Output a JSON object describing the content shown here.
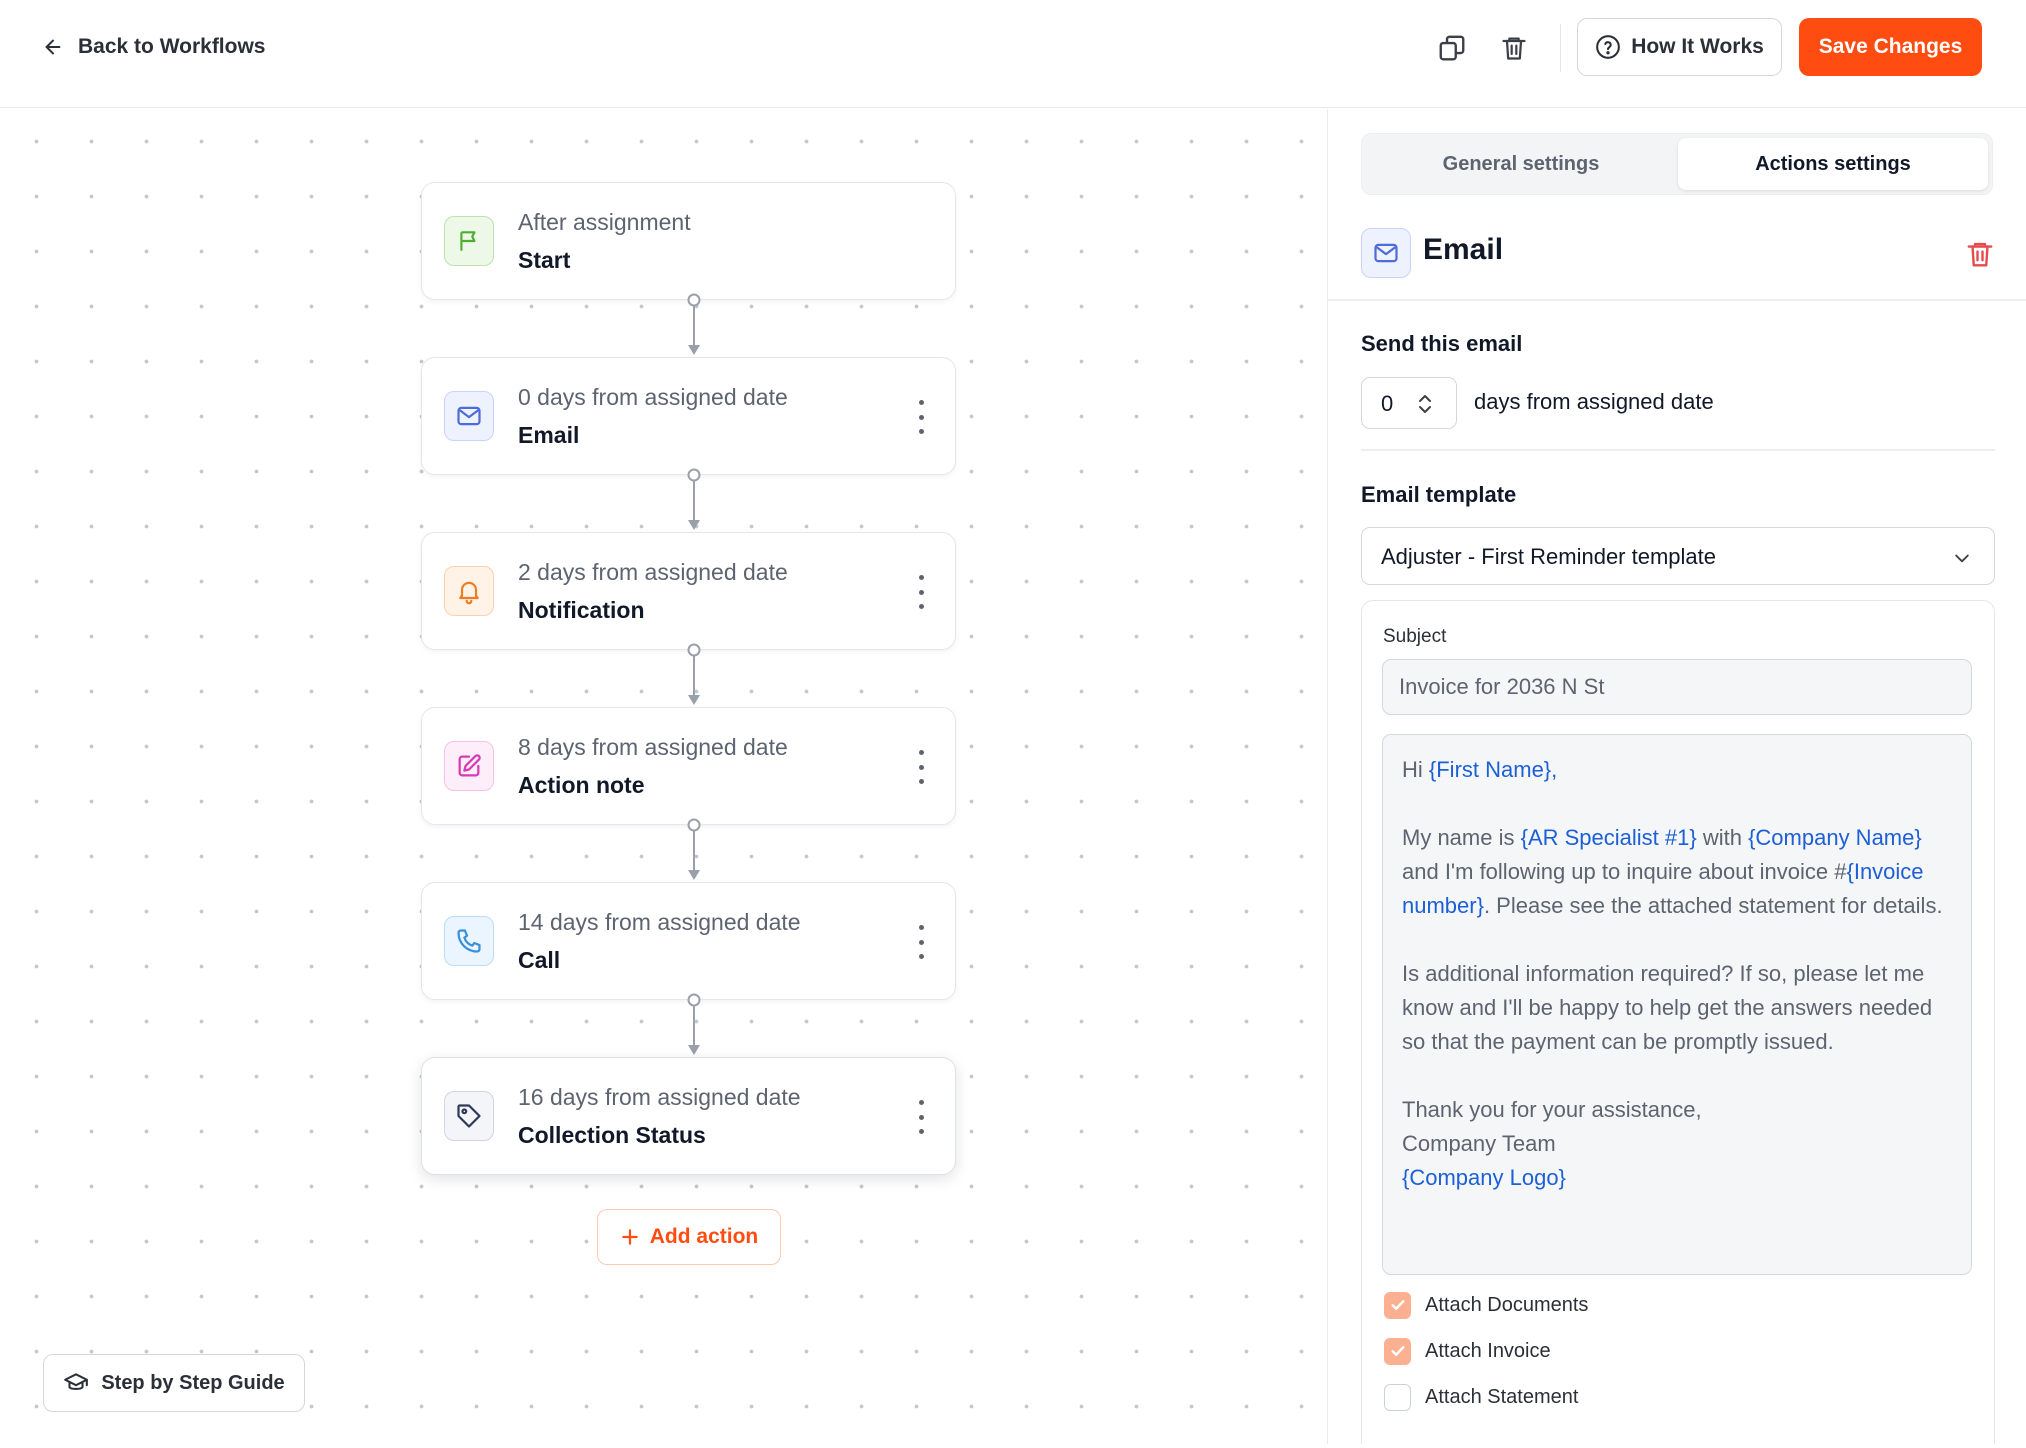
{
  "header": {
    "back_label": "Back to Workflows",
    "how_label": "How It Works",
    "save_label": "Save Changes"
  },
  "workflow": {
    "nodes": [
      {
        "subtitle": "After assignment",
        "title": "Start",
        "icon": "flag-icon",
        "color": "#4caf2e"
      },
      {
        "subtitle": "0 days from assigned date",
        "title": "Email",
        "icon": "mail-icon",
        "color": "#4f6bd8"
      },
      {
        "subtitle": "2 days from assigned date",
        "title": "Notification",
        "icon": "bell-icon",
        "color": "#f07d1f"
      },
      {
        "subtitle": "8 days from assigned date",
        "title": "Action note",
        "icon": "edit-note-icon",
        "color": "#d63bb3"
      },
      {
        "subtitle": "14 days from assigned date",
        "title": "Call",
        "icon": "phone-icon",
        "color": "#3a8fd9"
      },
      {
        "subtitle": "16 days from assigned date",
        "title": "Collection Status",
        "icon": "tag-icon",
        "color": "#2e3a59"
      }
    ],
    "add_action_label": "Add action",
    "guide_label": "Step by Step Guide"
  },
  "panel": {
    "tabs": [
      {
        "label": "General settings",
        "active": false
      },
      {
        "label": "Actions settings",
        "active": true
      }
    ],
    "action_title": "Email",
    "send_label": "Send this email",
    "days_value": "0",
    "days_suffix": "days from assigned date",
    "template_label": "Email template",
    "template_value": "Adjuster - First Reminder template",
    "subject_label": "Subject",
    "subject_value": "Invoice for 2036 N St",
    "body": {
      "greeting_prefix": "Hi ",
      "first_name_var": "{First Name},",
      "p1_a": "My name is ",
      "p1_var1": "{AR Specialist #1}",
      "p1_b": " with ",
      "p1_var2": "{Company Name}",
      "p1_c": " and I'm following up to inquire about invoice #",
      "p1_var3": "{Invoice number}",
      "p1_d": ". Please see the attached statement for details.",
      "p2": "Is additional information required? If so, please let me know and I'll be happy to help get the answers needed so that the payment can be promptly issued.",
      "p3_line1": "Thank you for your assistance,",
      "p3_line2": "Company Team",
      "logo_var": "{Company Logo}"
    },
    "attachments": [
      {
        "label": "Attach Documents",
        "checked": true
      },
      {
        "label": "Attach Invoice",
        "checked": true
      },
      {
        "label": "Attach Statement",
        "checked": false
      }
    ]
  },
  "colors": {
    "accent": "#ff4d12",
    "variable": "#1d5fd6",
    "checkbox_on": "#fbb091",
    "danger": "#e5484d"
  }
}
